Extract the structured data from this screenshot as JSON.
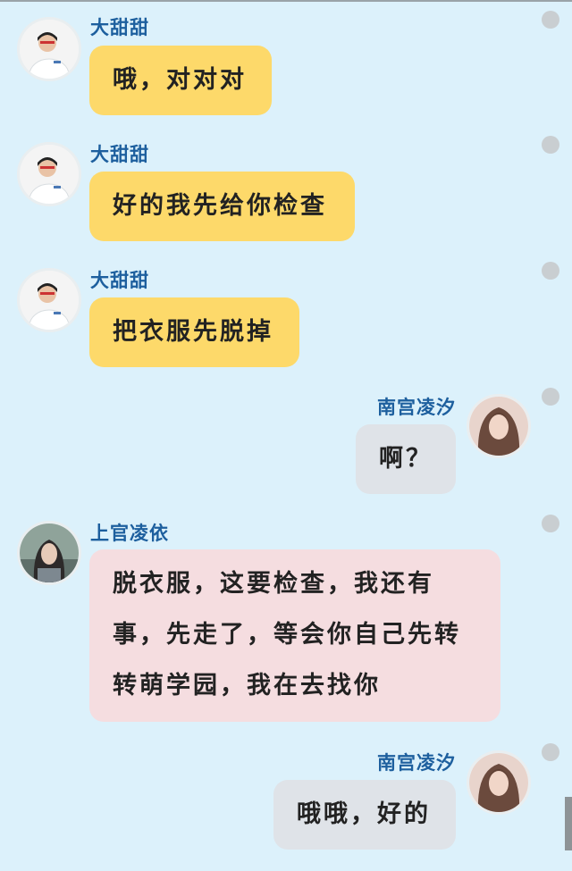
{
  "messages": [
    {
      "sender": "大甜甜",
      "side": "left",
      "text": "哦，对对对",
      "color": "#fdd96a",
      "avatar": "doctor-avatar"
    },
    {
      "sender": "大甜甜",
      "side": "left",
      "text": "好的我先给你检查",
      "color": "#fdd96a",
      "avatar": "doctor-avatar"
    },
    {
      "sender": "大甜甜",
      "side": "left",
      "text": "把衣服先脱掉",
      "color": "#fdd96a",
      "avatar": "doctor-avatar"
    },
    {
      "sender": "南宫凌汐",
      "side": "right",
      "text": "啊？",
      "color": "#dfe3e8",
      "avatar": "girl-avatar"
    },
    {
      "sender": "上官凌依",
      "side": "left",
      "text_lines": [
        "脱衣服，这要检查，我还有",
        "事，先走了，等会你自己先转",
        "转萌学园，我在去找你"
      ],
      "color": "#f5dde0",
      "avatar": "woman-avatar"
    },
    {
      "sender": "南宫凌汐",
      "side": "right",
      "text": "哦哦，好的",
      "color": "#dfe3e8",
      "avatar": "girl-avatar"
    }
  ]
}
